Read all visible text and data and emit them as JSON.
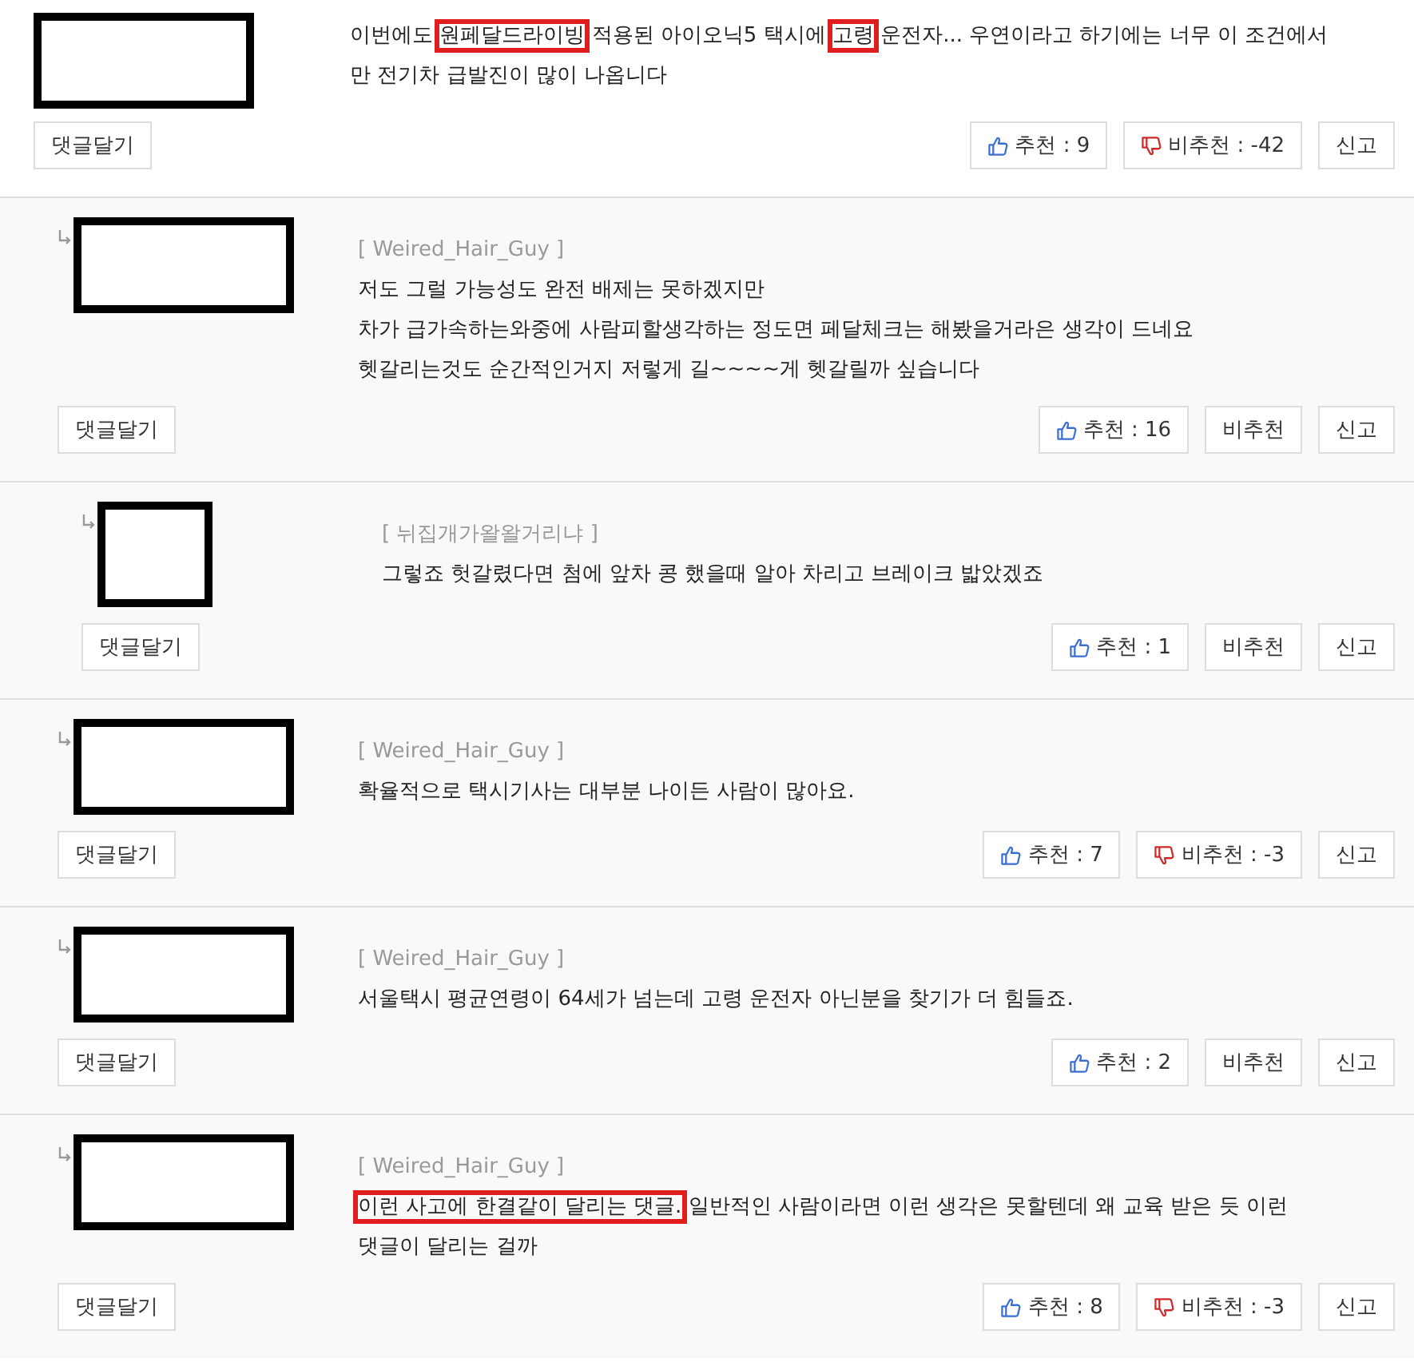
{
  "comment": {
    "lines": [
      {
        "parts": [
          {
            "text": "이번에도 ",
            "highlighted": false
          },
          {
            "text": "원페달드라이빙",
            "highlighted": true
          },
          {
            "text": " 적용된 아이오닉5 택시에 ",
            "highlighted": false
          },
          {
            "text": "고령",
            "highlighted": true
          },
          {
            "text": " 운전자... 우연이라고 하기에는 너무 이 조건에서",
            "highlighted": false
          }
        ]
      },
      {
        "parts": [
          {
            "text": "만 전기차 급발진이 많이 나옵니다",
            "highlighted": false
          }
        ]
      }
    ],
    "reply_button": "댓글달기",
    "like": "추천 : 9",
    "dislike": {
      "text": "비추천 : -42",
      "icon": true
    },
    "report": "신고",
    "children": [
      {
        "author": "[ Weired_Hair_Guy ]",
        "lines": [
          {
            "parts": [
              {
                "text": "저도 그럴 가능성도 완전 배제는 못하겠지만",
                "highlighted": false
              }
            ]
          },
          {
            "parts": [
              {
                "text": "차가 급가속하는와중에 사람피할생각하는 정도면 페달체크는 해봤을거라은 생각이 드네요",
                "highlighted": false
              }
            ]
          },
          {
            "parts": [
              {
                "text": "헷갈리는것도 순간적인거지 저렇게 길~~~~게 헷갈릴까 싶습니다",
                "highlighted": false
              }
            ]
          }
        ],
        "reply_button": "댓글달기",
        "like": "추천 : 16",
        "dislike": {
          "text": "비추천",
          "icon": false
        },
        "report": "신고",
        "children": [
          {
            "author": "[ 뉘집개가왈왈거리냐 ]",
            "lines": [
              {
                "parts": [
                  {
                    "text": "그렇죠 헛갈렸다면 첨에 앞차 콩 했을때 알아 차리고 브레이크 밟았겠죠",
                    "highlighted": false
                  }
                ]
              }
            ],
            "reply_button": "댓글달기",
            "like": "추천 : 1",
            "dislike": {
              "text": "비추천",
              "icon": false
            },
            "report": "신고"
          }
        ]
      },
      {
        "author": "[ Weired_Hair_Guy ]",
        "lines": [
          {
            "parts": [
              {
                "text": "확율적으로 택시기사는 대부분 나이든 사람이 많아요.",
                "highlighted": false
              }
            ]
          }
        ],
        "reply_button": "댓글달기",
        "like": "추천 : 7",
        "dislike": {
          "text": "비추천 : -3",
          "icon": true
        },
        "report": "신고"
      },
      {
        "author": "[ Weired_Hair_Guy ]",
        "lines": [
          {
            "parts": [
              {
                "text": "서울택시 평균연령이 64세가 넘는데 고령 운전자 아닌분을 찾기가 더 힘들죠.",
                "highlighted": false
              }
            ]
          }
        ],
        "reply_button": "댓글달기",
        "like": "추천 : 2",
        "dislike": {
          "text": "비추천",
          "icon": false
        },
        "report": "신고"
      },
      {
        "author": "[ Weired_Hair_Guy ]",
        "lines": [
          {
            "parts": [
              {
                "text": "이런 사고에 한결같이 달리는 댓글.",
                "highlighted": true
              },
              {
                "text": " 일반적인 사람이라면 이런 생각은 못할텐데 왜 교육 받은 듯 이런",
                "highlighted": false
              }
            ]
          },
          {
            "parts": [
              {
                "text": "댓글이 달리는 걸까",
                "highlighted": false
              }
            ]
          }
        ],
        "reply_button": "댓글달기",
        "like": "추천 : 8",
        "dislike": {
          "text": "비추천 : -3",
          "icon": true
        },
        "report": "신고"
      }
    ]
  }
}
